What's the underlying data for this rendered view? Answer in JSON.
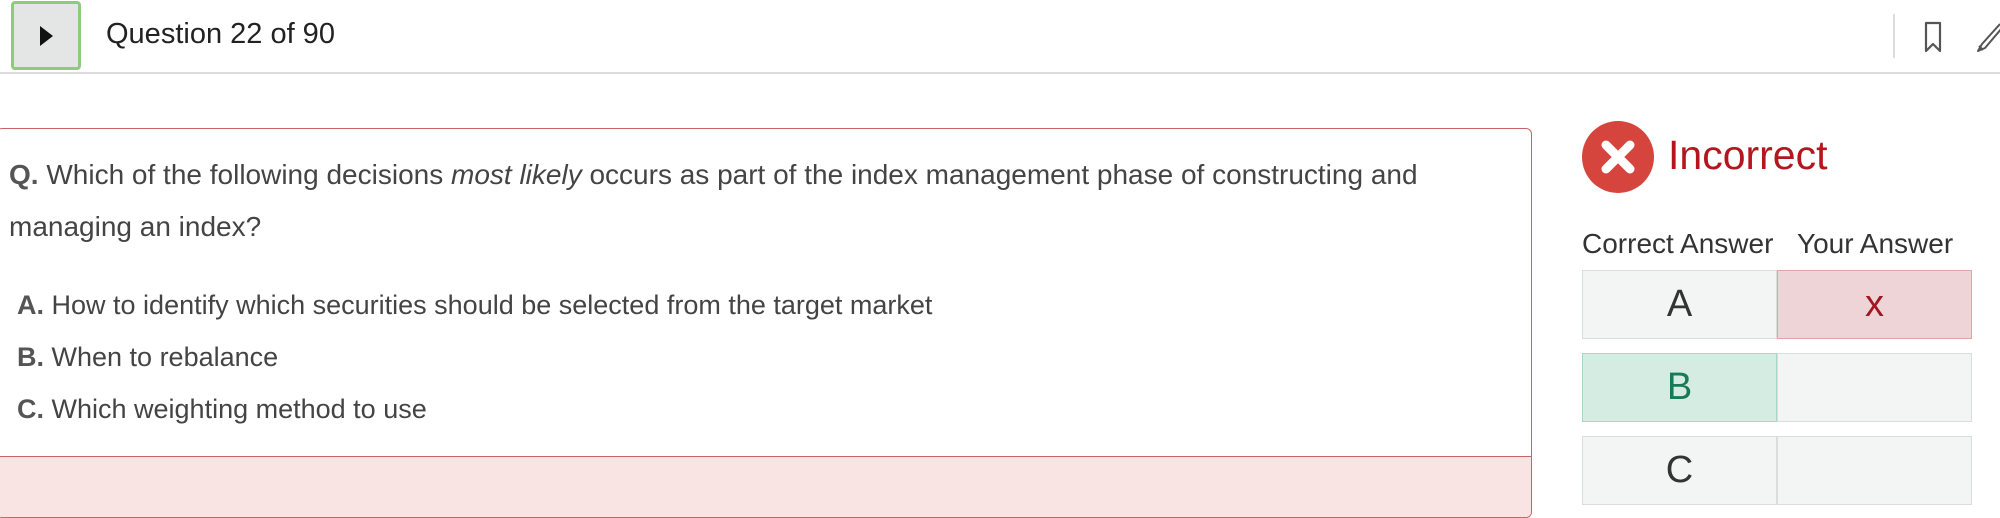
{
  "header": {
    "question_counter": "Question 22 of 90",
    "icons": [
      "play-icon",
      "bookmark-icon",
      "pencil-icon"
    ]
  },
  "question": {
    "label": "Q.",
    "text_before": "Which of the following decisions",
    "text_emphasis": "most likely",
    "text_after": "occurs as part of the index management phase of constructing and managing an index?",
    "options": [
      {
        "letter": "A.",
        "text": "How to identify which securities should be selected from the target market"
      },
      {
        "letter": "B.",
        "text": "When to rebalance"
      },
      {
        "letter": "C.",
        "text": "Which weighting method to use"
      }
    ]
  },
  "result": {
    "status": "Incorrect",
    "icon": "x-circle-icon",
    "correct_answer_header": "Correct Answer",
    "your_answer_header": "Your Answer",
    "rows": [
      {
        "correct": "A",
        "yours": "x"
      },
      {
        "correct": "B",
        "yours": ""
      },
      {
        "correct": "C",
        "yours": ""
      }
    ]
  },
  "colors": {
    "incorrect": "#b3171e",
    "incorrect_icon": "#d6453d",
    "correct_highlight": "#d5ece3",
    "wrong_highlight": "#efd4d7",
    "card_border": "#c86464",
    "play_border": "#8fcb7c"
  }
}
